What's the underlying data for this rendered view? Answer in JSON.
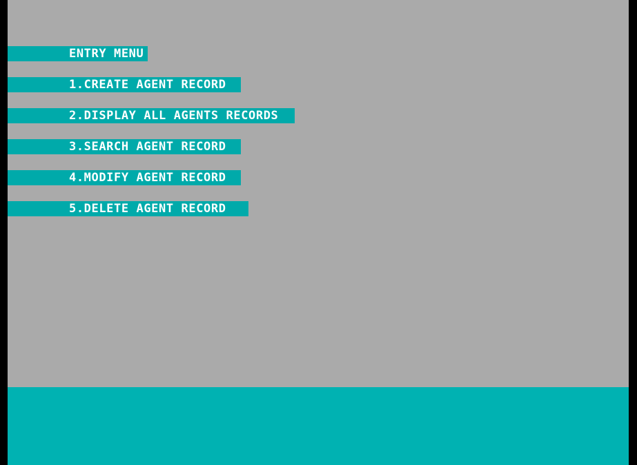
{
  "menu": {
    "title": "ENTRY MENU",
    "items": [
      {
        "label": "1.CREATE AGENT RECORD"
      },
      {
        "label": "2.DISPLAY ALL AGENTS RECORDS"
      },
      {
        "label": "3.SEARCH AGENT RECORD"
      },
      {
        "label": "4.MODIFY AGENT RECORD"
      },
      {
        "label": "5.DELETE AGENT RECORD"
      }
    ]
  },
  "colors": {
    "background": "#AAAAAA",
    "highlight": "#00AAAA",
    "text": "#FFFFFF",
    "status_bar": "#00B2B2",
    "frame": "#000000"
  }
}
